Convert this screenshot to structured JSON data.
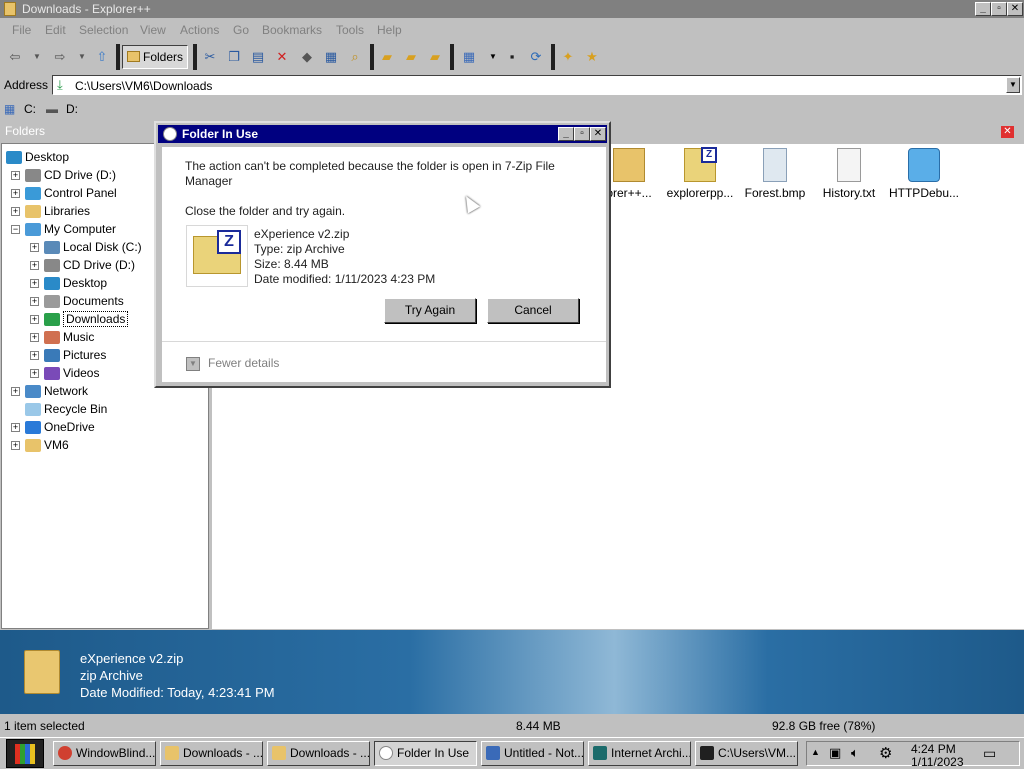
{
  "window": {
    "title": "Downloads - Explorer++",
    "min": "_",
    "max": "▫",
    "close": "✕"
  },
  "menu": [
    "File",
    "Edit",
    "Selection",
    "View",
    "Actions",
    "Go",
    "Bookmarks",
    "Tools",
    "Help"
  ],
  "toolbar": {
    "folders_label": "Folders"
  },
  "address": {
    "label": "Address",
    "value": "C:\\Users\\VM6\\Downloads"
  },
  "drives": [
    "C:",
    "D:"
  ],
  "tree": {
    "header": "Folders",
    "items": [
      {
        "label": "Desktop",
        "icon": "desktop-icon"
      },
      {
        "label": "CD Drive (D:)",
        "icon": "cd-drive-icon"
      },
      {
        "label": "Control Panel",
        "icon": "control-panel-icon"
      },
      {
        "label": "Libraries",
        "icon": "folder-icon"
      },
      {
        "label": "My Computer",
        "icon": "computer-icon"
      },
      {
        "label": "Local Disk (C:)",
        "icon": "disk-icon"
      },
      {
        "label": "CD Drive (D:)",
        "icon": "cd-drive-icon"
      },
      {
        "label": "Desktop",
        "icon": "desktop-icon"
      },
      {
        "label": "Documents",
        "icon": "documents-icon"
      },
      {
        "label": "Downloads",
        "icon": "download-icon"
      },
      {
        "label": "Music",
        "icon": "music-icon"
      },
      {
        "label": "Pictures",
        "icon": "pictures-icon"
      },
      {
        "label": "Videos",
        "icon": "videos-icon"
      },
      {
        "label": "Network",
        "icon": "network-icon"
      },
      {
        "label": "Recycle Bin",
        "icon": "recycle-bin-icon"
      },
      {
        "label": "OneDrive",
        "icon": "cloud-icon"
      },
      {
        "label": "VM6",
        "icon": "folder-icon"
      }
    ]
  },
  "files": [
    {
      "label": "orer++...",
      "icon": "folder-icon"
    },
    {
      "label": "explorerpp...",
      "icon": "zip-icon"
    },
    {
      "label": "Forest.bmp",
      "icon": "image-icon"
    },
    {
      "label": "History.txt",
      "icon": "text-file-icon"
    },
    {
      "label": "HTTPDebu...",
      "icon": "app-icon"
    }
  ],
  "dialog": {
    "title": "Folder In Use",
    "message": "The action can't be completed because the folder is open in 7-Zip File Manager",
    "hint": "Close the folder and try again.",
    "file_name": "eXperience v2.zip",
    "file_type": "Type: zip Archive",
    "file_size": "Size: 8.44 MB",
    "file_modified": "Date modified: 1/11/2023 4:23 PM",
    "try_again": "Try Again",
    "cancel": "Cancel",
    "fewer_details": "Fewer details"
  },
  "preview": {
    "name": "eXperience v2.zip",
    "type": "zip Archive",
    "modified": "Date Modified: Today, 4:23:41 PM"
  },
  "status": {
    "selected": "1 item selected",
    "size": "8.44 MB",
    "free": "92.8 GB free (78%)"
  },
  "taskbar": {
    "items": [
      {
        "label": "WindowBlind...",
        "color": "#d04030"
      },
      {
        "label": "Downloads - ...",
        "color": "#e8c36a"
      },
      {
        "label": "Downloads - ...",
        "color": "#e8c36a"
      },
      {
        "label": "Folder In Use",
        "color": "#ffffff"
      },
      {
        "label": "Untitled - Not...",
        "color": "#3a6ab8"
      },
      {
        "label": "Internet Archi...",
        "color": "#1a6a6a"
      },
      {
        "label": "C:\\Users\\VM...",
        "color": "#202020"
      }
    ],
    "time": "4:24 PM",
    "date": "1/11/2023"
  }
}
